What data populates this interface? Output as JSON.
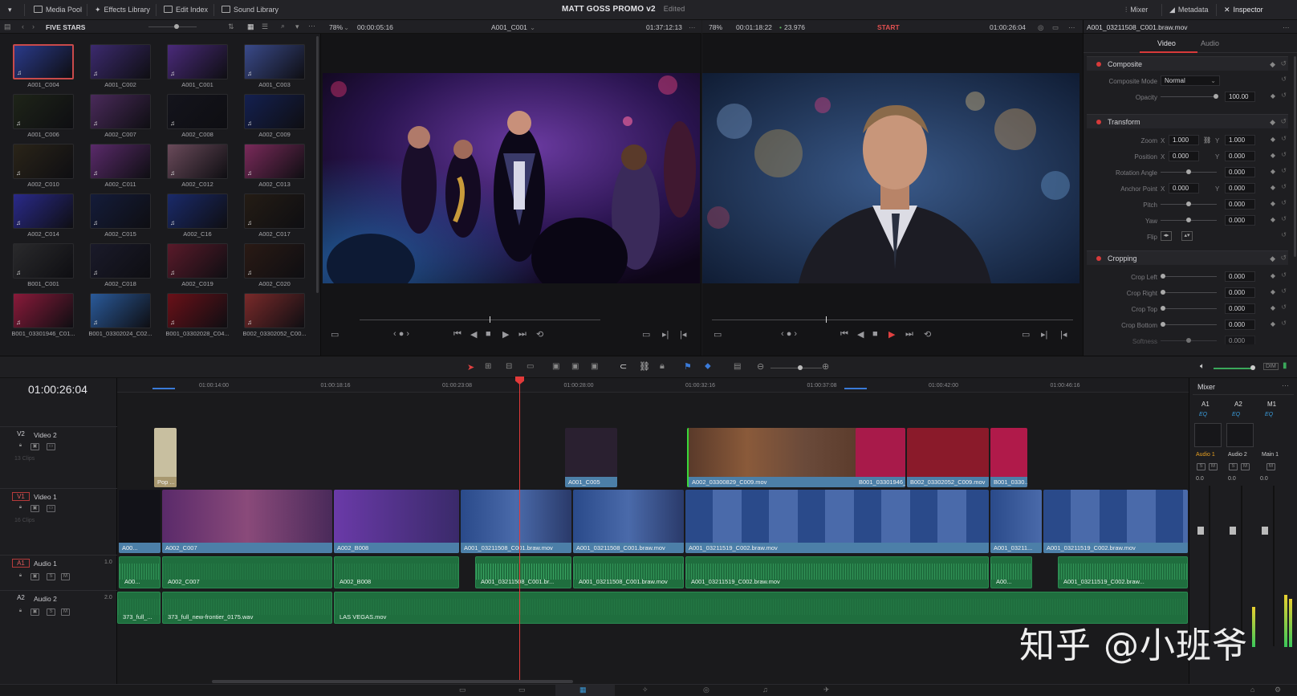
{
  "topbar": {
    "media_pool": "Media Pool",
    "effects_library": "Effects Library",
    "edit_index": "Edit Index",
    "sound_library": "Sound Library",
    "project_title": "MATT GOSS PROMO v2",
    "project_status": "Edited",
    "mixer": "Mixer",
    "metadata": "Metadata",
    "inspector": "Inspector"
  },
  "media_pool": {
    "bin_name": "FIVE STARS",
    "clips": [
      {
        "name": "A001_C004",
        "color": "#2a3a8a",
        "selected": true
      },
      {
        "name": "A001_C002",
        "color": "#3c2a6e"
      },
      {
        "name": "A001_C001",
        "color": "#4a2a7a"
      },
      {
        "name": "A001_C003",
        "color": "#3a4a8a"
      },
      {
        "name": "A001_C006",
        "color": "#1e2418"
      },
      {
        "name": "A002_C007",
        "color": "#4a2a5a"
      },
      {
        "name": "A002_C008",
        "color": "#14141c"
      },
      {
        "name": "A002_C009",
        "color": "#142050"
      },
      {
        "name": "A002_C010",
        "color": "#2a2418"
      },
      {
        "name": "A002_C011",
        "color": "#5a2a6a"
      },
      {
        "name": "A002_C012",
        "color": "#6a4a5a"
      },
      {
        "name": "A002_C013",
        "color": "#7a2a5a"
      },
      {
        "name": "A002_C014",
        "color": "#2a2a8a"
      },
      {
        "name": "A002_C015",
        "color": "#141c3a"
      },
      {
        "name": "A002_C16",
        "color": "#1a2a6a"
      },
      {
        "name": "A002_C017",
        "color": "#241c14"
      },
      {
        "name": "B001_C001",
        "color": "#2a2a2c"
      },
      {
        "name": "A002_C018",
        "color": "#1a1a2a"
      },
      {
        "name": "A002_C019",
        "color": "#5a1a2a"
      },
      {
        "name": "A002_C020",
        "color": "#2a1a14"
      },
      {
        "name": "B001_03301946_C01...",
        "color": "#8a1a3a"
      },
      {
        "name": "B001_03302024_C02...",
        "color": "#2a5a9a"
      },
      {
        "name": "B001_03302028_C04...",
        "color": "#6a1018"
      },
      {
        "name": "B002_03302052_C00...",
        "color": "#7a2a2a"
      }
    ]
  },
  "source_viewer": {
    "zoom": "78%",
    "duration": "00:00:05:16",
    "clip": "A001_C001",
    "timecode": "01:37:12:13"
  },
  "timeline_viewer": {
    "zoom": "78%",
    "duration": "00:01:18:22",
    "fps": "23.976",
    "marker": "START",
    "timecode": "01:00:26:04"
  },
  "inspector": {
    "clip_name": "A001_03211508_C001.braw.mov",
    "tab_video": "Video",
    "tab_audio": "Audio",
    "composite": {
      "title": "Composite",
      "mode_label": "Composite Mode",
      "mode_value": "Normal",
      "opacity_label": "Opacity",
      "opacity_value": "100.00"
    },
    "transform": {
      "title": "Transform",
      "zoom_label": "Zoom",
      "zoom_x": "1.000",
      "zoom_y": "1.000",
      "position_label": "Position",
      "position_x": "0.000",
      "position_y": "0.000",
      "rotation_label": "Rotation Angle",
      "rotation_value": "0.000",
      "anchor_label": "Anchor Point",
      "anchor_x": "0.000",
      "anchor_y": "0.000",
      "pitch_label": "Pitch",
      "pitch_value": "0.000",
      "yaw_label": "Yaw",
      "yaw_value": "0.000",
      "flip_label": "Flip"
    },
    "cropping": {
      "title": "Cropping",
      "left_label": "Crop Left",
      "left_value": "0.000",
      "right_label": "Crop Right",
      "right_value": "0.000",
      "top_label": "Crop Top",
      "top_value": "0.000",
      "bottom_label": "Crop Bottom",
      "bottom_value": "0.000",
      "softness_label": "Softness",
      "softness_value": "0.000"
    }
  },
  "timeline": {
    "timecode": "01:00:26:04",
    "ruler": [
      "01:00:14:00",
      "01:00:18:16",
      "01:00:23:08",
      "01:00:28:00",
      "01:00:32:16",
      "01:00:37:08",
      "01:00:42:00",
      "01:00:46:16"
    ],
    "v2": {
      "id": "V2",
      "name": "Video 2",
      "count": "13 Clips"
    },
    "v1": {
      "id": "V1",
      "name": "Video 1",
      "count": "16 Clips"
    },
    "a1": {
      "id": "A1",
      "name": "Audio 1",
      "level": "1.0"
    },
    "a2": {
      "id": "A2",
      "name": "Audio 2",
      "level": "2.0"
    },
    "v2_clips": [
      "Pop ...",
      "A001_C005",
      "A002_03300829_C009.mov",
      "B001_03301946_...",
      "B002_03302052_C009.mov",
      "B001_0330..."
    ],
    "v1_clips": [
      "A00...",
      "A002_C007",
      "A002_B008",
      "A001_03211508_C001.braw.mov",
      "A001_03211508_C001.braw.mov",
      "A001_03211519_C002.braw.mov",
      "A001_03211...",
      "A001_03211519_C002.braw.mov"
    ],
    "a1_clips": [
      "A00...",
      "A002_C007",
      "A002_B008",
      "A001_03211508_C001.br...",
      "A001_03211508_C001.braw.mov",
      "A001_03211519_C002.braw.mov",
      "A00...",
      "A001_03211519_C002.braw..."
    ],
    "a2_clips": [
      "373_full_...",
      "373_full_new-frontier_0175.wav",
      "LAS VEGAS.mov"
    ]
  },
  "mixer": {
    "title": "Mixer",
    "channels": [
      "A1",
      "A2",
      "M1"
    ],
    "eq": "EQ",
    "names": [
      "Audio 1",
      "Audio 2",
      "Main 1"
    ],
    "levels": [
      "0.0",
      "0.0",
      "0.0"
    ]
  },
  "watermark": "知乎 @小班爷",
  "colors": {
    "accent": "#d83a3a",
    "video_clip": "#4c7fa8",
    "audio_clip": "#1f6e3e",
    "playhead": "#e23a3a"
  }
}
